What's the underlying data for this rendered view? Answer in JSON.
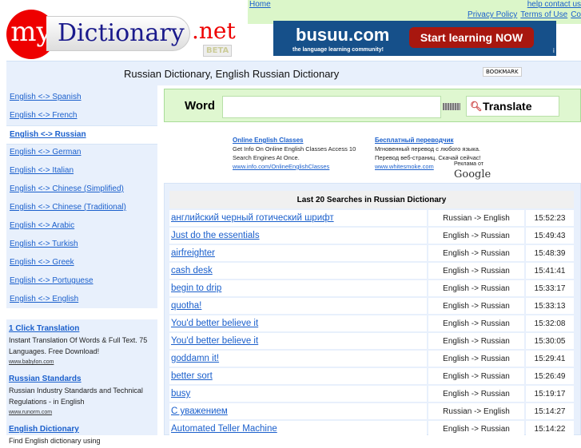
{
  "logo": {
    "my": "my",
    "name": "Dictionary",
    "tld": ".net",
    "beta": "BETA"
  },
  "top_links": {
    "home": "Home",
    "help": "help contact us",
    "privacy": "Privacy Policy",
    "terms": "Terms of Use",
    "more": "Co"
  },
  "banner": {
    "brand": "busuu.com",
    "tagline": "the language learning community!",
    "cta": "Start learning NOW",
    "info": "i"
  },
  "page_title": "Russian Dictionary, English Russian Dictionary",
  "bookmark": "BOOKMARK",
  "sidebar": {
    "items": [
      {
        "label": "English <-> Spanish"
      },
      {
        "label": "English <-> French"
      },
      {
        "label": "English <-> Russian",
        "selected": true
      },
      {
        "label": "English <-> German"
      },
      {
        "label": "English <-> Italian"
      },
      {
        "label": "English <-> Chinese (Simplified)"
      },
      {
        "label": "English <-> Chinese (Traditional)"
      },
      {
        "label": "English <-> Arabic"
      },
      {
        "label": "English <-> Turkish"
      },
      {
        "label": "English <-> Greek"
      },
      {
        "label": "English <-> Portuguese"
      },
      {
        "label": "English <-> English"
      }
    ],
    "ads": [
      {
        "title": "1 Click Translation",
        "text": "Instant Translation Of Words & Full Text. 75 Languages. Free Download!",
        "url": "www.babylon.com"
      },
      {
        "title": "Russian Standards",
        "text": "Russian Industry Standards and Technical Regulations - in English",
        "url": "www.runorm.com"
      },
      {
        "title": "English Dictionary",
        "text": "Find English dictionary using",
        "url": ""
      }
    ]
  },
  "search": {
    "label": "Word",
    "value": "",
    "button": "Translate"
  },
  "google_ads": {
    "ads": [
      {
        "title": "Online English Classes",
        "line1": "Get Info On Online English Classes Access 10",
        "line2": "Search Engines At Once.",
        "url": "www.info.com/OnlineEnglishClasses"
      },
      {
        "title": "Бесплатный переводчик",
        "line1": "Мгновенный перевод с любого языка.",
        "line2": "Перевод веб-страниц. Скачай сейчас!",
        "url": "www.whitesmoke.com"
      }
    ],
    "by": "Реклама от",
    "brand": "Google"
  },
  "recent": {
    "title": "Last 20 Searches in Russian Dictionary",
    "rows": [
      {
        "word": "английский черный готический шрифт",
        "dir": "Russian -> English",
        "time": "15:52:23"
      },
      {
        "word": "Just do the essentials",
        "dir": "English -> Russian",
        "time": "15:49:43"
      },
      {
        "word": "airfreighter",
        "dir": "English -> Russian",
        "time": "15:48:39"
      },
      {
        "word": "cash desk",
        "dir": "English -> Russian",
        "time": "15:41:41"
      },
      {
        "word": "begin to drip",
        "dir": "English -> Russian",
        "time": "15:33:17"
      },
      {
        "word": "quotha!",
        "dir": "English -> Russian",
        "time": "15:33:13"
      },
      {
        "word": "You'd better believe it",
        "dir": "English -> Russian",
        "time": "15:32:08"
      },
      {
        "word": "You'd better believe it",
        "dir": "English -> Russian",
        "time": "15:30:05"
      },
      {
        "word": "goddamn it!",
        "dir": "English -> Russian",
        "time": "15:29:41"
      },
      {
        "word": "better sort",
        "dir": "English -> Russian",
        "time": "15:26:49"
      },
      {
        "word": "busy",
        "dir": "English -> Russian",
        "time": "15:19:17"
      },
      {
        "word": "С уважением",
        "dir": "Russian -> English",
        "time": "15:14:27"
      },
      {
        "word": "Automated Teller Machine",
        "dir": "English -> Russian",
        "time": "15:14:22"
      }
    ]
  }
}
